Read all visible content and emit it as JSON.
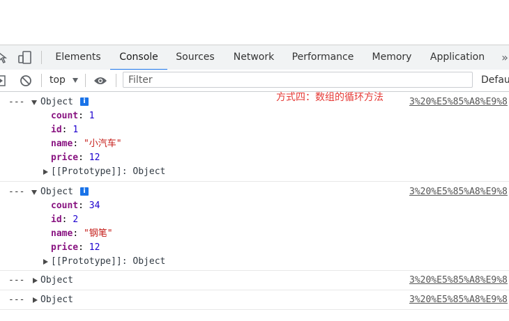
{
  "devtools": {
    "tabs": [
      {
        "label": "Elements"
      },
      {
        "label": "Console"
      },
      {
        "label": "Sources"
      },
      {
        "label": "Network"
      },
      {
        "label": "Performance"
      },
      {
        "label": "Memory"
      },
      {
        "label": "Application"
      }
    ],
    "more_tabs": "»",
    "active_tab": "Console",
    "accent": "#1a73e8"
  },
  "toolbar": {
    "context": "top",
    "filter_placeholder": "Filter",
    "levels_label": "Defau"
  },
  "annotation": "方式四：数组的循环方法",
  "console": {
    "source_link": "3%20%E5%85%A8%E9%8",
    "messages": [
      {
        "prefix": "---",
        "label": "Object",
        "expanded": true,
        "props": [
          {
            "key": "count",
            "value": "1",
            "kind": "num"
          },
          {
            "key": "id",
            "value": "1",
            "kind": "num"
          },
          {
            "key": "name",
            "value": "\"小汽车\"",
            "kind": "str"
          },
          {
            "key": "price",
            "value": "12",
            "kind": "num"
          }
        ],
        "prototype": "[[Prototype]]: Object"
      },
      {
        "prefix": "---",
        "label": "Object",
        "expanded": true,
        "props": [
          {
            "key": "count",
            "value": "34",
            "kind": "num"
          },
          {
            "key": "id",
            "value": "2",
            "kind": "num"
          },
          {
            "key": "name",
            "value": "\"钢笔\"",
            "kind": "str"
          },
          {
            "key": "price",
            "value": "12",
            "kind": "num"
          }
        ],
        "prototype": "[[Prototype]]: Object"
      },
      {
        "prefix": "---",
        "label": "Object",
        "expanded": false
      },
      {
        "prefix": "---",
        "label": "Object",
        "expanded": false
      }
    ]
  }
}
